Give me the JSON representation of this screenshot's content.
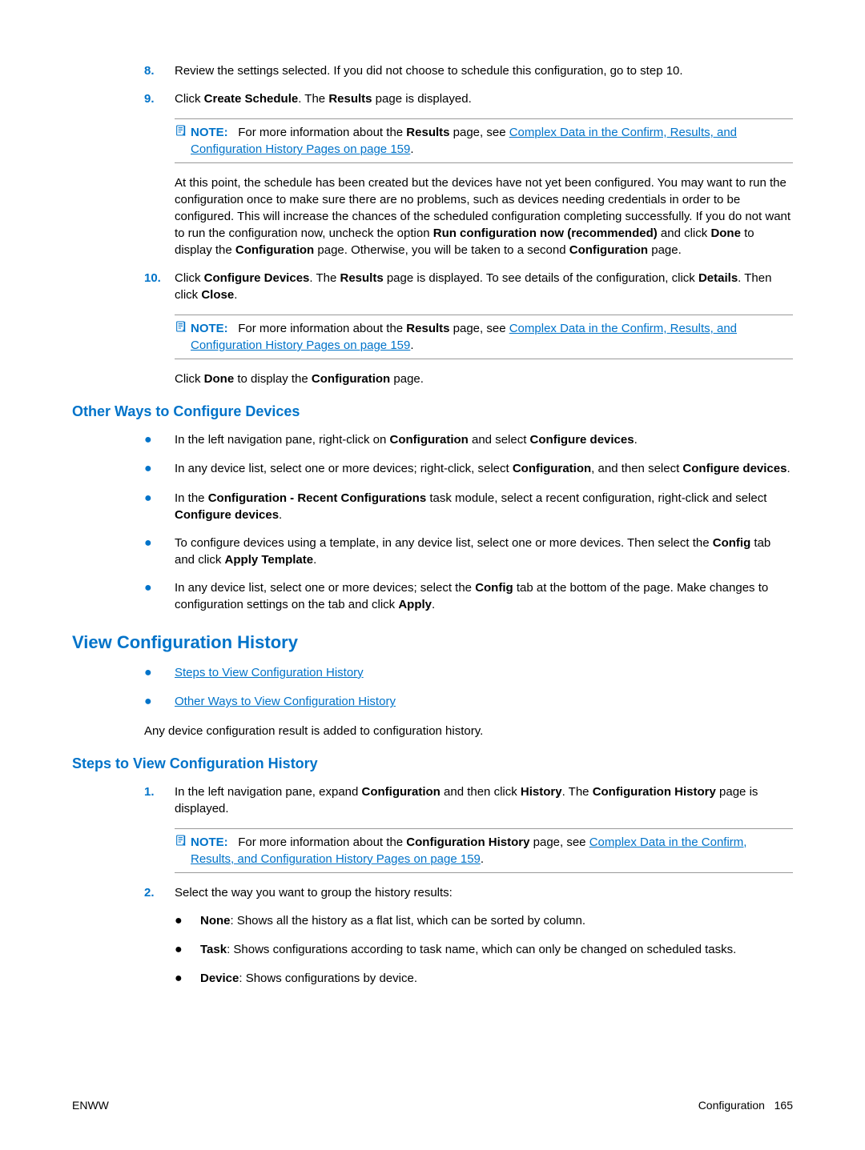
{
  "steps": {
    "s8": {
      "num": "8.",
      "text_a": "Review the settings selected. If you did not choose to schedule this configuration, go to step 10."
    },
    "s9": {
      "num": "9.",
      "text_a": "Click ",
      "b1": "Create Schedule",
      "text_b": ". The ",
      "b2": "Results",
      "text_c": " page is displayed."
    },
    "s10": {
      "num": "10.",
      "text_a": "Click ",
      "b1": "Configure Devices",
      "text_b": ". The ",
      "b2": "Results",
      "text_c": " page is displayed. To see details of the configuration, click ",
      "b3": "Details",
      "text_d": ". Then click ",
      "b4": "Close",
      "text_e": "."
    }
  },
  "note1": {
    "label": "NOTE:",
    "t1": "For more information about the ",
    "b1": "Results",
    "t2": " page, see ",
    "link": "Complex Data in the Confirm, Results, and Configuration History Pages on page 159",
    "t3": "."
  },
  "para_schedule": {
    "t1": "At this point, the schedule has been created but the devices have not yet been configured. You may want to run the configuration once to make sure there are no problems, such as devices needing credentials in order to be configured. This will increase the chances of the scheduled configuration completing successfully. If you do not want to run the configuration now, uncheck the option ",
    "b1": "Run configuration now (recommended)",
    "t2": " and click ",
    "b2": "Done",
    "t3": " to display the ",
    "b3": "Configuration",
    "t4": " page. Otherwise, you will be taken to a second ",
    "b4": "Configuration",
    "t5": " page."
  },
  "note2": {
    "label": "NOTE:",
    "t1": "For more information about the ",
    "b1": "Results",
    "t2": " page, see ",
    "link": "Complex Data in the Confirm, Results, and Configuration History Pages on page 159",
    "t3": "."
  },
  "para_done": {
    "t1": "Click ",
    "b1": "Done",
    "t2": " to display the ",
    "b2": "Configuration",
    "t3": " page."
  },
  "h3_other": "Other Ways to Configure Devices",
  "bullets_other": {
    "i1": {
      "t1": "In the left navigation pane, right-click on ",
      "b1": "Configuration",
      "t2": " and select ",
      "b2": "Configure devices",
      "t3": "."
    },
    "i2": {
      "t1": "In any device list, select one or more devices; right-click, select ",
      "b1": "Configuration",
      "t2": ", and then select ",
      "b2": "Configure devices",
      "t3": "."
    },
    "i3": {
      "t1": "In the ",
      "b1": "Configuration - Recent Configurations",
      "t2": " task module, select a recent configuration, right-click and select ",
      "b2": "Configure devices",
      "t3": "."
    },
    "i4": {
      "t1": "To configure devices using a template, in any device list, select one or more devices. Then select the ",
      "b1": "Config",
      "t2": " tab and click ",
      "b2": "Apply Template",
      "t3": "."
    },
    "i5": {
      "t1": "In any device list, select one or more devices; select the ",
      "b1": "Config",
      "t2": " tab at the bottom of the page. Make changes to configuration settings on the tab and click ",
      "b2": "Apply",
      "t3": "."
    }
  },
  "h2_view": "View Configuration History",
  "links_view": {
    "l1": "Steps to View Configuration History",
    "l2": "Other Ways to View Configuration History"
  },
  "para_anydevice": "Any device configuration result is added to configuration history.",
  "h3_steps": "Steps to View Configuration History",
  "hist": {
    "s1": {
      "num": "1.",
      "t1": "In the left navigation pane, expand ",
      "b1": "Configuration",
      "t2": " and then click ",
      "b2": "History",
      "t3": ". The ",
      "b3": "Configuration History",
      "t4": " page is displayed."
    },
    "s2": {
      "num": "2.",
      "t1": "Select the way you want to group the history results:"
    }
  },
  "note3": {
    "label": "NOTE:",
    "t1": "For more information about the ",
    "b1": "Configuration History",
    "t2": " page, see ",
    "link": "Complex Data in the Confirm, Results, and Configuration History Pages on page 159",
    "t3": "."
  },
  "group_opts": {
    "o1": {
      "b": "None",
      "t": ": Shows all the history as a flat list, which can be sorted by column."
    },
    "o2": {
      "b": "Task",
      "t": ": Shows configurations according to task name, which can only be changed on scheduled tasks."
    },
    "o3": {
      "b": "Device",
      "t": ": Shows configurations by device."
    }
  },
  "footer": {
    "left": "ENWW",
    "right_label": "Configuration",
    "right_page": "165"
  }
}
